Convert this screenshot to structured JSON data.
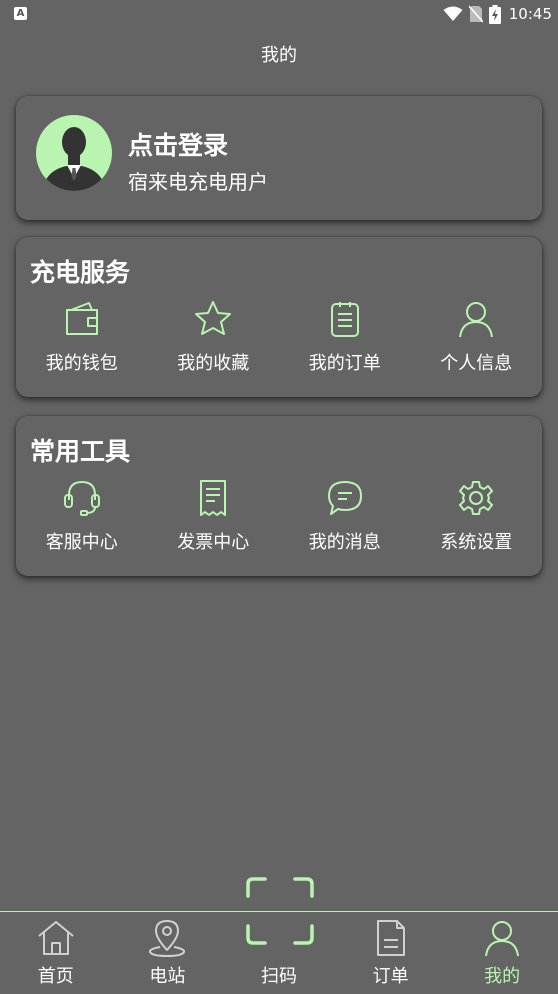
{
  "status_bar": {
    "app_badge": "A",
    "time": "10:45"
  },
  "header": {
    "title": "我的"
  },
  "login": {
    "title": "点击登录",
    "subtitle": "宿来电充电用户"
  },
  "charging_service": {
    "title": "充电服务",
    "items": [
      {
        "label": "我的钱包",
        "icon": "wallet-icon"
      },
      {
        "label": "我的收藏",
        "icon": "star-icon"
      },
      {
        "label": "我的订单",
        "icon": "clipboard-icon"
      },
      {
        "label": "个人信息",
        "icon": "person-icon"
      }
    ]
  },
  "common_tools": {
    "title": "常用工具",
    "items": [
      {
        "label": "客服中心",
        "icon": "headset-icon"
      },
      {
        "label": "发票中心",
        "icon": "receipt-icon"
      },
      {
        "label": "我的消息",
        "icon": "chat-bubble-icon"
      },
      {
        "label": "系统设置",
        "icon": "gear-icon"
      }
    ]
  },
  "tabbar": {
    "items": [
      {
        "label": "首页",
        "icon": "home-icon"
      },
      {
        "label": "电站",
        "icon": "location-pin-icon"
      },
      {
        "label": "扫码",
        "icon": "scan-icon"
      },
      {
        "label": "订单",
        "icon": "document-icon"
      },
      {
        "label": "我的",
        "icon": "person-icon",
        "active": true
      }
    ]
  },
  "colors": {
    "background": "#646464",
    "accent": "#b9f4b0",
    "text": "#ffffff"
  }
}
